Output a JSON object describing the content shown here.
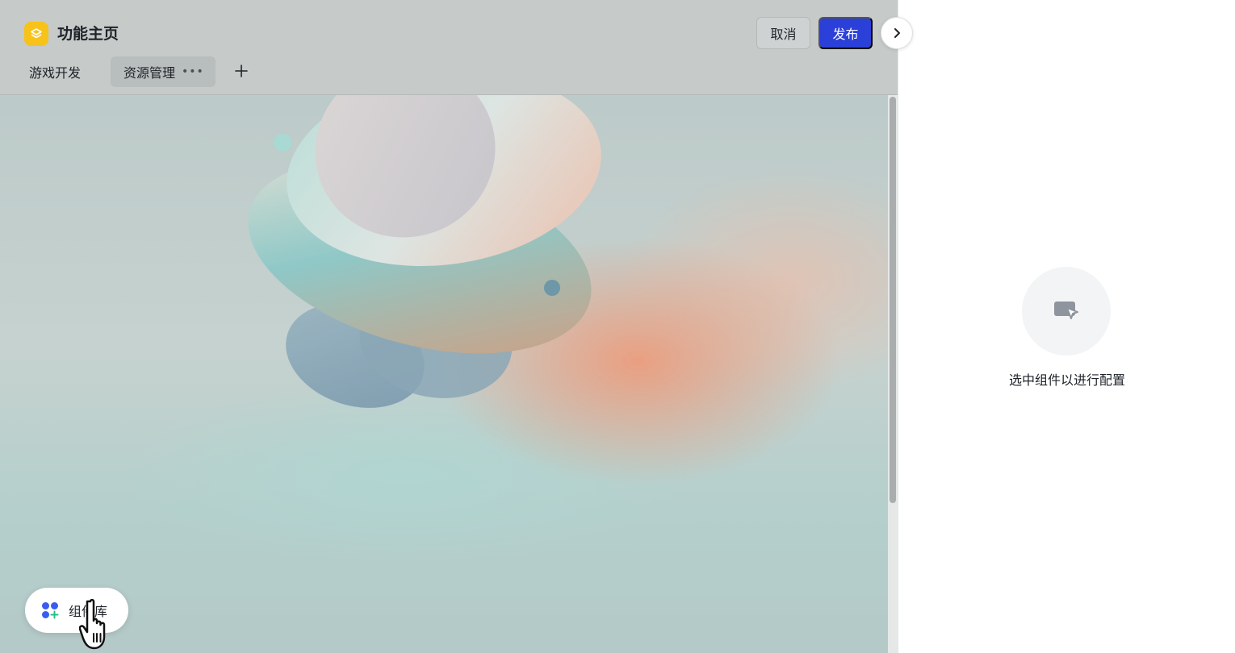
{
  "header": {
    "title": "功能主页",
    "cancel_label": "取消",
    "publish_label": "发布"
  },
  "tabs": [
    {
      "label": "游戏开发",
      "active": false
    },
    {
      "label": "资源管理",
      "active": true,
      "more": "•••"
    }
  ],
  "tab_add": "+",
  "icons": {
    "logo": "layers-icon",
    "add_tab": "plus-icon",
    "collapse": "chevron-right-icon",
    "empty_state": "cursor-select-icon",
    "component_library": "grid-plus-icon"
  },
  "component_library": {
    "label": "组件库"
  },
  "right_panel": {
    "empty_text": "选中组件以进行配置"
  },
  "colors": {
    "accent": "#2b3fd9",
    "logo": "#f7c21a",
    "panel_bg": "#ffffff"
  }
}
